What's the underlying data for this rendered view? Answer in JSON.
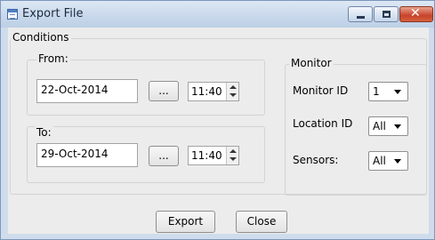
{
  "window": {
    "title": "Export File"
  },
  "conditions": {
    "legend": "Conditions",
    "from": {
      "legend": "From:",
      "date": "22-Oct-2014",
      "browse_label": "...",
      "time": "11:40"
    },
    "to": {
      "legend": "To:",
      "date": "29-Oct-2014",
      "browse_label": "...",
      "time": "11:40"
    },
    "monitor": {
      "legend": "Monitor",
      "monitor_id": {
        "label": "Monitor ID",
        "value": "1"
      },
      "location_id": {
        "label": "Location ID",
        "value": "All"
      },
      "sensors": {
        "label": "Sensors:",
        "value": "All"
      }
    }
  },
  "actions": {
    "export_label": "Export",
    "close_label": "Close"
  },
  "icons": {
    "app": "form-icon",
    "minimize": "minimize-icon",
    "maximize": "maximize-icon",
    "close": "close-icon",
    "spin": "spin-updown-icon",
    "dropdown": "chevron-down-icon"
  },
  "colors": {
    "title_bar": "#c9d8eb",
    "close_button": "#c8432a",
    "dialog_bg": "#ececec"
  }
}
